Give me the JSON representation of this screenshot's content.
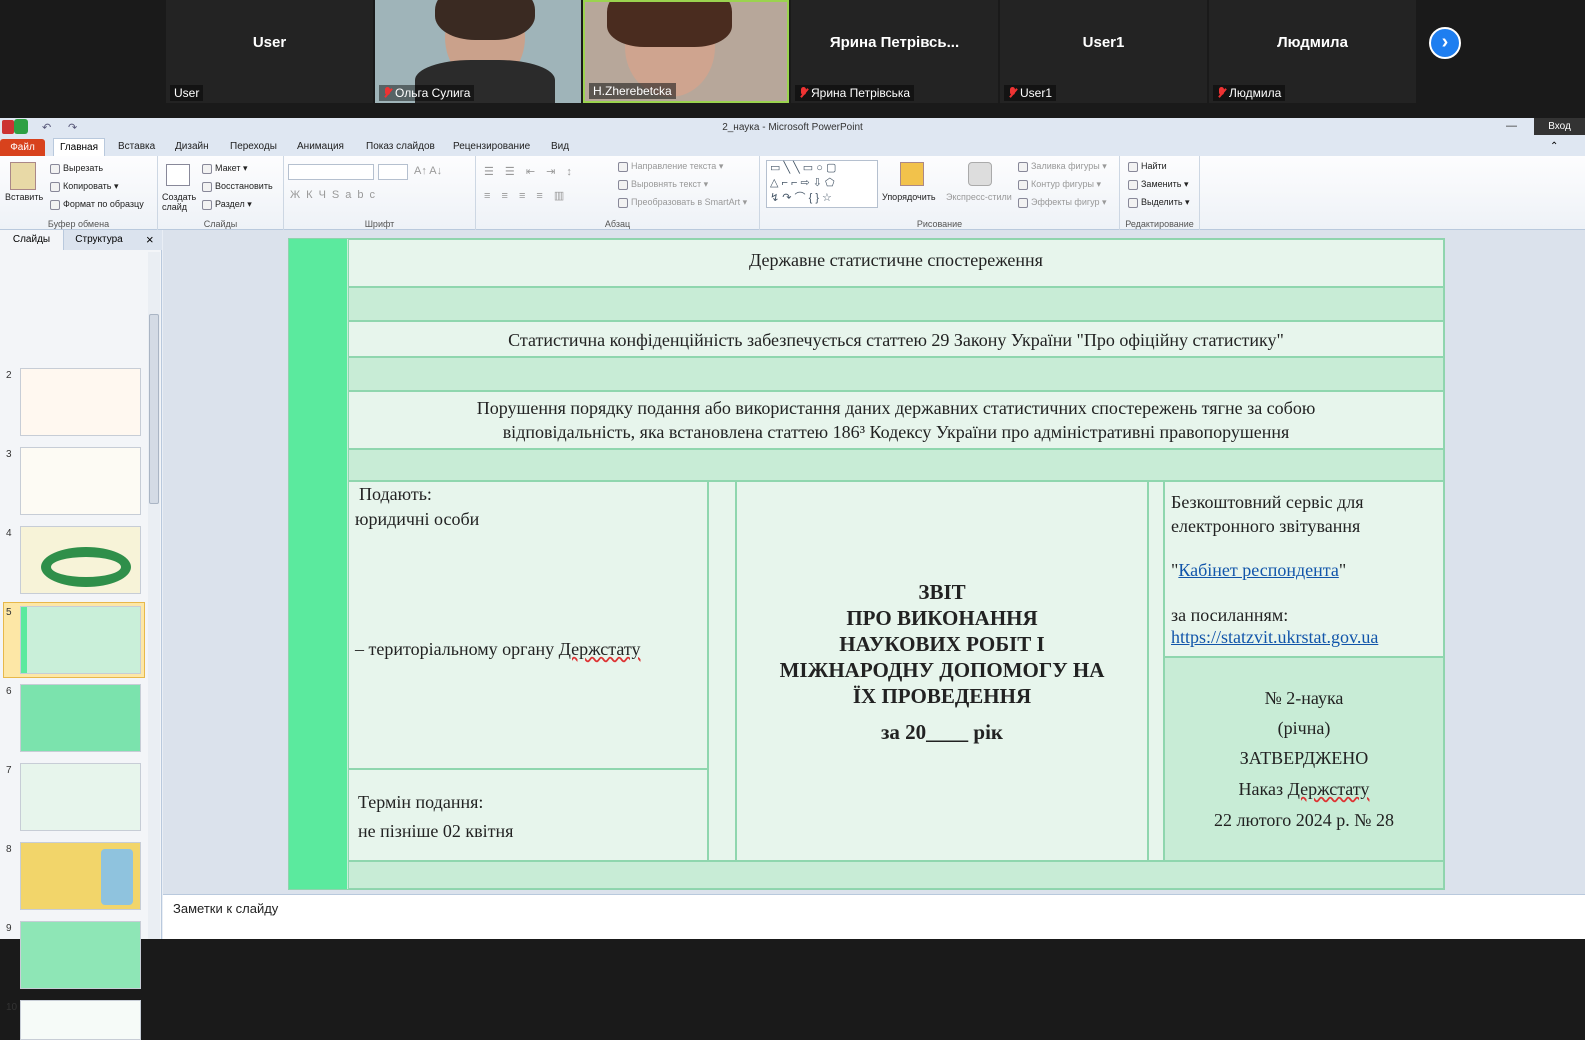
{
  "video_strip": {
    "tiles": [
      {
        "big": "User",
        "small": "User"
      },
      {
        "big": "",
        "small": "Ольга Сулига"
      },
      {
        "big": "",
        "small": "H.Zherebetcka"
      },
      {
        "big": "Ярина  Петрівсь...",
        "small": "Ярина Петрівська"
      },
      {
        "big": "User1",
        "small": "User1"
      },
      {
        "big": "Людмила",
        "small": "Людмила"
      }
    ],
    "next": "›"
  },
  "app": {
    "title": "2_наука  -  Microsoft PowerPoint",
    "signin": "Вход"
  },
  "tabs": {
    "file": "Файл",
    "home": "Главная",
    "insert": "Вставка",
    "design": "Дизайн",
    "transitions": "Переходы",
    "animation": "Анимация",
    "slideshow": "Показ слайдов",
    "review": "Рецензирование",
    "view": "Вид"
  },
  "ribbon": {
    "paste": "Вставить",
    "cut": "Вырезать",
    "copy": "Копировать",
    "format_painter": "Формат по образцу",
    "clipboard_group": "Буфер обмена",
    "new_slide": "Создать слайд",
    "layout": "Макет",
    "reset": "Восстановить",
    "section": "Раздел",
    "slides_group": "Слайды",
    "font_group": "Шрифт",
    "text_direction": "Направление текста",
    "align_text": "Выровнять текст",
    "smartart": "Преобразовать в SmartArt",
    "paragraph_group": "Абзац",
    "arrange": "Упорядочить",
    "quick_styles": "Экспресс-стили",
    "shape_fill": "Заливка фигуры",
    "shape_outline": "Контур фигуры",
    "shape_effects": "Эффекты фигур",
    "drawing_group": "Рисование",
    "find": "Найти",
    "replace": "Заменить",
    "select": "Выделить",
    "editing_group": "Редактирование"
  },
  "panel": {
    "tab_slides": "Слайды",
    "tab_outline": "Структура",
    "close": "×",
    "slide_numbers": [
      "2",
      "3",
      "4",
      "5",
      "6",
      "7",
      "8",
      "9",
      "10"
    ],
    "selected_slide": "5"
  },
  "slide": {
    "header": "Державне статистичне спостереження",
    "confidentiality": "Статистична конфіденційність забезпечується статтею 29 Закону України \"Про офіційну статистику\"",
    "violation_line1": "Порушення порядку подання або використання даних державних статистичних спостережень тягне за собою",
    "violation_line2": "відповідальність, яка встановлена статтею 186³ Кодексу України про адміністративні правопорушення",
    "submit_label": "Подають:",
    "submit_who": "юридичні особи",
    "submit_to_prefix": "– територіальному органу ",
    "submit_to_org": "Держстату",
    "deadline_label": "Термін подання:",
    "deadline_value": "не пізніше 02 квітня",
    "report_line1": "ЗВІТ",
    "report_line2": "ПРО ВИКОНАННЯ",
    "report_line3": "НАУКОВИХ РОБІТ І",
    "report_line4": "МІЖНАРОДНУ ДОПОМОГУ НА",
    "report_line5": "ЇХ ПРОВЕДЕННЯ",
    "report_period": "за 20____ рік",
    "service_line1": "Безкоштовний сервіс для",
    "service_line2": "електронного звітування",
    "service_quote_open": "\"",
    "service_link": "Кабінет респондента",
    "service_quote_close": "\"",
    "service_by_link": "за посиланням:",
    "service_url": "https://statzvit.ukrstat.gov.ua",
    "form_number": "№ 2-наука",
    "form_period": "(річна)",
    "approved": "ЗАТВЕРДЖЕНО",
    "order_prefix": "Наказ ",
    "order_org": "Держстату",
    "order_date": "22 лютого 2024 р. № 28"
  },
  "notes": {
    "placeholder": "Заметки к слайду"
  },
  "colors": {
    "accent_bar": "#5bea9e",
    "slide_bg": "#c9efd9",
    "file_tab": "#d8421d",
    "next_button": "#1e7ef0"
  }
}
